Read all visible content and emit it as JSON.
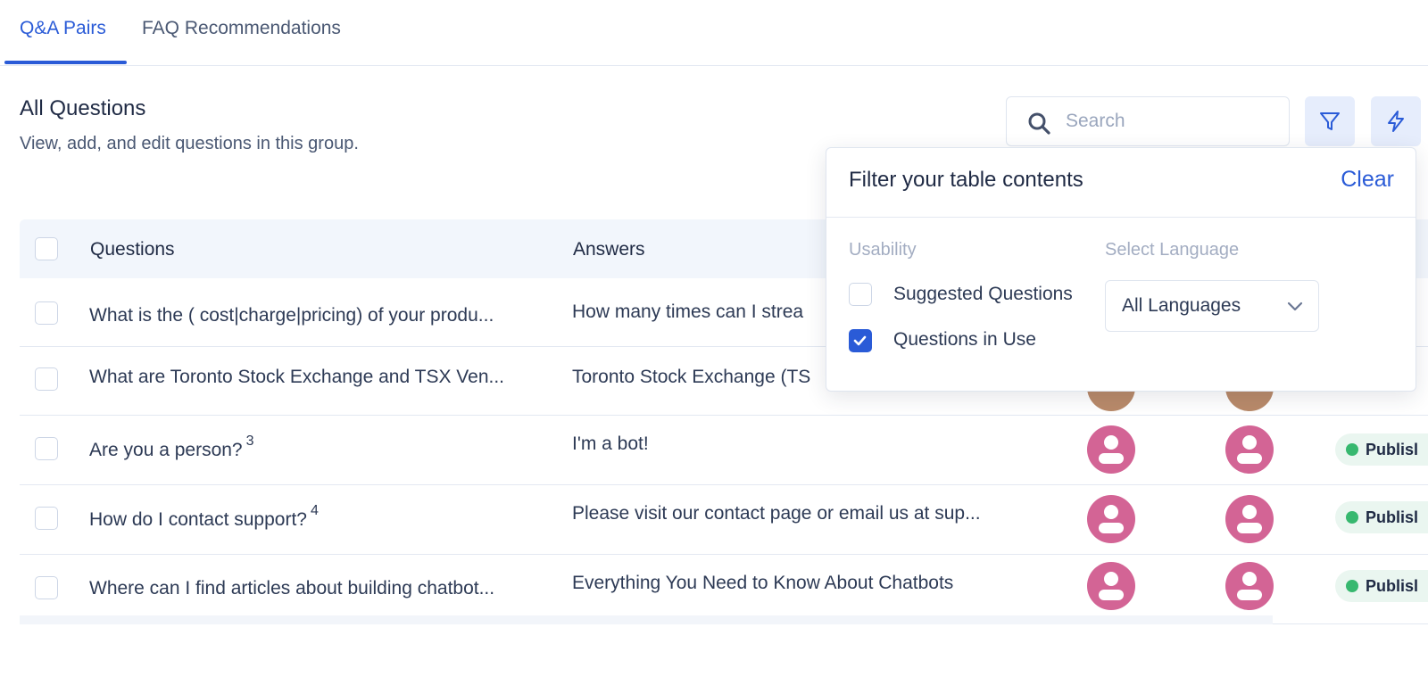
{
  "tabs": [
    {
      "label": "Q&A Pairs",
      "active": true
    },
    {
      "label": "FAQ Recommendations",
      "active": false
    }
  ],
  "section": {
    "title": "All Questions",
    "subtitle": "View, add, and edit questions in this group."
  },
  "search": {
    "placeholder": "Search",
    "value": ""
  },
  "toolbar": {
    "filter_icon": "filter-icon",
    "actions_icon": "lightning-icon"
  },
  "table": {
    "headers": {
      "questions": "Questions",
      "answers": "Answers"
    },
    "rows": [
      {
        "question": "What is the ( cost|charge|pricing) of your produ...",
        "count": "",
        "answer": "How many times can I strea",
        "status": "",
        "avatar": "photo"
      },
      {
        "question": "What are Toronto Stock Exchange and TSX Ven...",
        "count": "",
        "answer": "Toronto Stock Exchange (TS",
        "status": "",
        "avatar": "photo"
      },
      {
        "question": "Are you a person?",
        "count": "3",
        "answer": "I'm a bot!",
        "status": "Publisl",
        "avatar": "default"
      },
      {
        "question": "How do I contact support?",
        "count": "4",
        "answer": "Please visit our contact page or email us at sup...",
        "status": "Publisl",
        "avatar": "default"
      },
      {
        "question": "Where can I find articles about building chatbot...",
        "count": "",
        "answer": "Everything You Need to Know About Chatbots",
        "status": "Publisl",
        "avatar": "default"
      }
    ]
  },
  "filter": {
    "title": "Filter your table contents",
    "clear_label": "Clear",
    "usability_label": "Usability",
    "language_label": "Select Language",
    "options": [
      {
        "label": "Suggested Questions",
        "checked": false
      },
      {
        "label": "Questions in Use",
        "checked": true
      }
    ],
    "language_value": "All Languages"
  },
  "colors": {
    "accent": "#2a5bd7",
    "avatar": "#d36495",
    "status_dot": "#37b86f"
  }
}
